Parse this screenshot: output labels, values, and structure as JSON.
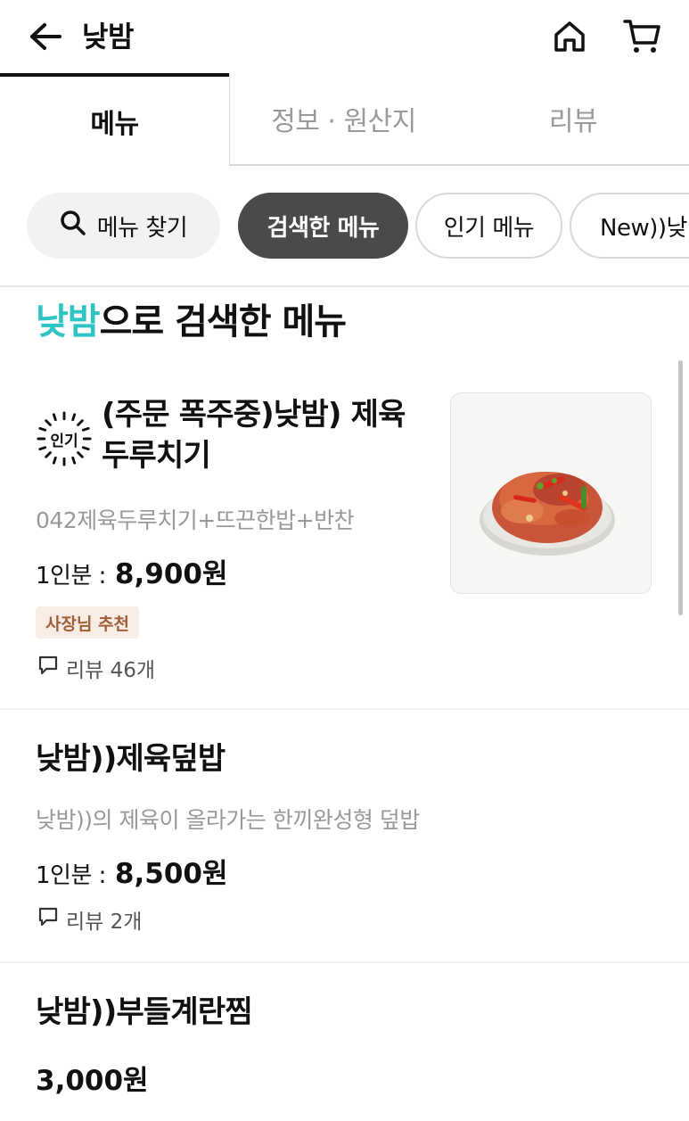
{
  "header": {
    "title": "낮밤"
  },
  "tabs": [
    {
      "label": "메뉴",
      "active": true
    },
    {
      "label": "정보 · 원산지",
      "active": false
    },
    {
      "label": "리뷰",
      "active": false
    }
  ],
  "chips": {
    "search": "메뉴 찾기",
    "searched": "검색한 메뉴",
    "popular": "인기 메뉴",
    "new": "New))낮"
  },
  "section": {
    "keyword": "낮밤",
    "suffix": "으로 검색한 메뉴"
  },
  "items": [
    {
      "badge": "인기",
      "name": "(주문 폭주중)낮밤) 제육 두루치기",
      "description": "042제육두루치기+뜨끈한밥+반찬",
      "portion": "1인분 :",
      "price": "8,900원",
      "tag": "사장님 추천",
      "reviews": "리뷰 46개"
    },
    {
      "name": "낮밤))제육덮밥",
      "description": "낮밤))의 제육이 올라가는 한끼완성형 덮밥",
      "portion": "1인분 :",
      "price": "8,500원",
      "reviews": "리뷰 2개"
    },
    {
      "name": "낮밤))부들계란찜",
      "price": "3,000원"
    }
  ],
  "colors": {
    "accent": "#2ec4c4",
    "chip_active": "#4a4a4a",
    "tag_bg": "#f7ede5",
    "tag_text": "#a0603a"
  }
}
